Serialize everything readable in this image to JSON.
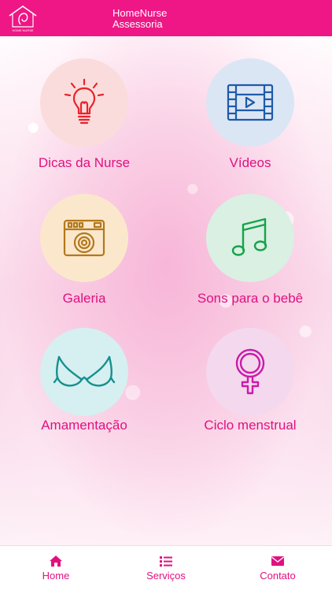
{
  "header": {
    "app_title_line1": "HomeNurse",
    "app_title_line2": "Assessoria",
    "logo_name": "home-nurse-logo",
    "logo_tagline": "HOME NURSE"
  },
  "menu": {
    "items": [
      {
        "label": "Dicas da Nurse",
        "icon": "lightbulb-icon",
        "circle_color": "#fbdcdc",
        "icon_color": "#e8222a"
      },
      {
        "label": "Vídeos",
        "icon": "film-play-icon",
        "circle_color": "#dbe6f5",
        "icon_color": "#1f5aa8"
      },
      {
        "label": "Galeria",
        "icon": "camera-icon",
        "circle_color": "#fbe8cc",
        "icon_color": "#b3781d"
      },
      {
        "label": "Sons para o bebê",
        "icon": "music-note-icon",
        "circle_color": "#daf0e3",
        "icon_color": "#17a34a"
      },
      {
        "label": "Amamentação",
        "icon": "bra-icon",
        "circle_color": "#d6eff0",
        "icon_color": "#16908e"
      },
      {
        "label": "Ciclo menstrual",
        "icon": "female-symbol-icon",
        "circle_color": "#f4d8ee",
        "icon_color": "#c91ca8"
      }
    ]
  },
  "navbar": {
    "items": [
      {
        "label": "Home",
        "icon": "home-icon"
      },
      {
        "label": "Serviços",
        "icon": "list-icon"
      },
      {
        "label": "Contato",
        "icon": "envelope-icon"
      }
    ]
  },
  "colors": {
    "brand": "#ef1685",
    "label": "#e0117f"
  }
}
